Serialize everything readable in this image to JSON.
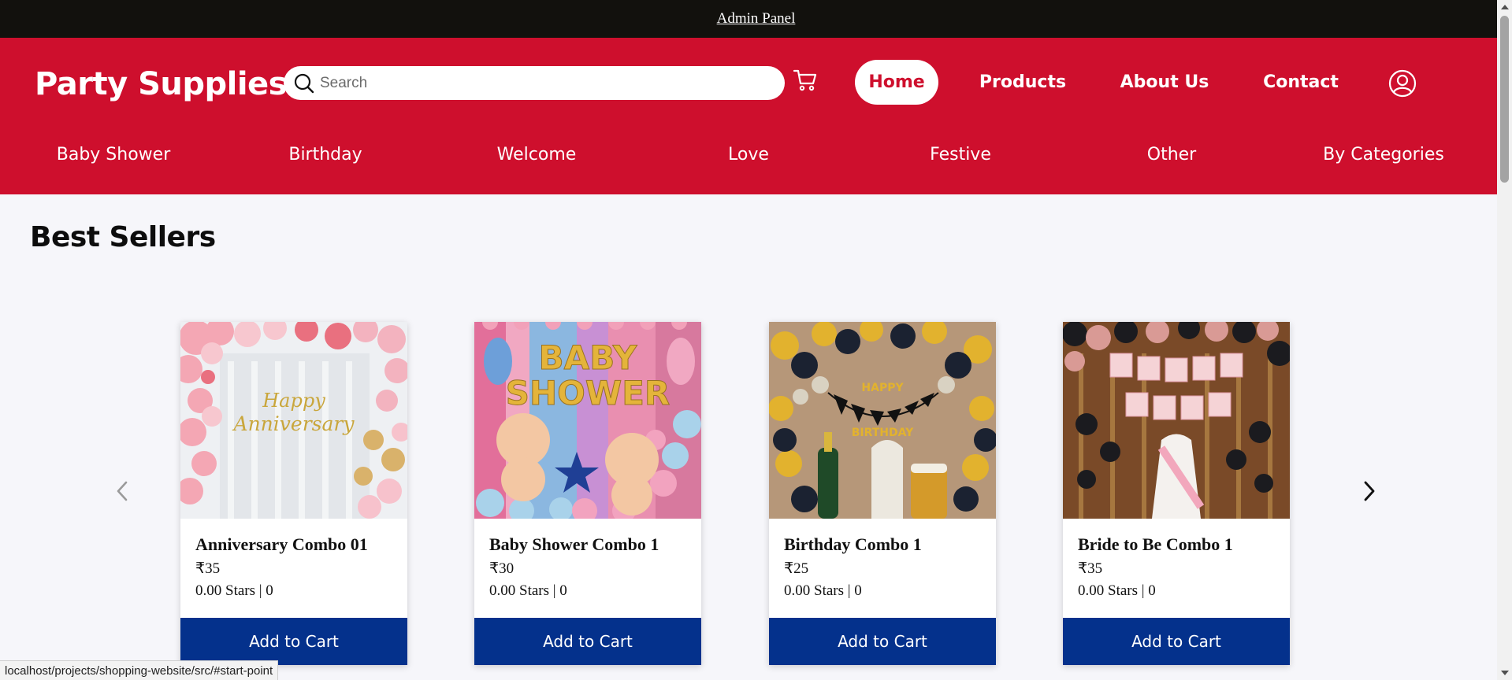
{
  "admin_bar": {
    "link_label": "Admin Panel"
  },
  "header": {
    "logo": "Party Supplies",
    "search": {
      "placeholder": "Search",
      "value": ""
    },
    "nav": [
      {
        "label": "Home",
        "active": true
      },
      {
        "label": "Products",
        "active": false
      },
      {
        "label": "About Us",
        "active": false
      },
      {
        "label": "Contact",
        "active": false
      }
    ],
    "categories": [
      "Baby Shower",
      "Birthday",
      "Welcome",
      "Love",
      "Festive",
      "Other",
      "By Categories"
    ]
  },
  "main": {
    "section_title": "Best Sellers",
    "products": [
      {
        "name": "Anniversary Combo 01",
        "price": "₹35",
        "rating": "0.00 Stars | 0",
        "button": "Add to Cart"
      },
      {
        "name": "Baby Shower Combo 1",
        "price": "₹30",
        "rating": "0.00 Stars | 0",
        "button": "Add to Cart"
      },
      {
        "name": "Birthday Combo 1",
        "price": "₹25",
        "rating": "0.00 Stars | 0",
        "button": "Add to Cart"
      },
      {
        "name": "Bride to Be Combo 1",
        "price": "₹35",
        "rating": "0.00 Stars | 0",
        "button": "Add to Cart"
      }
    ]
  },
  "status_bar": {
    "url": "localhost/projects/shopping-website/src/#start-point"
  },
  "colors": {
    "header_red": "#ce0f2d",
    "admin_black": "#12110d",
    "button_blue": "#04318c",
    "page_bg": "#f6f6fa"
  }
}
